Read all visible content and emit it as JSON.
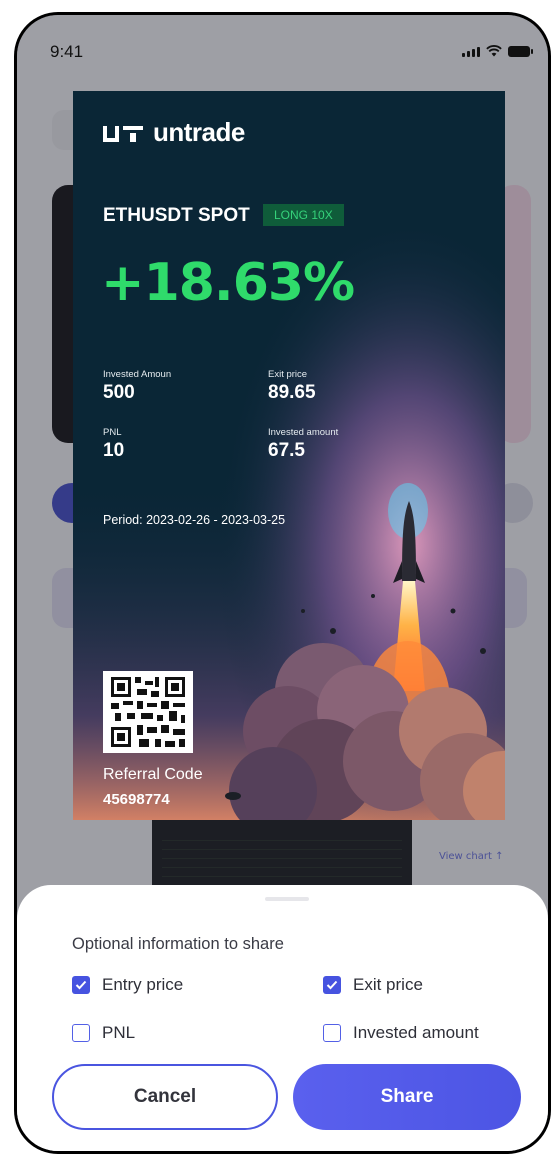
{
  "status_bar": {
    "time": "9:41"
  },
  "background": {
    "view_chart": "View chart ↑"
  },
  "share_card": {
    "brand": "untrade",
    "pair": "ETHUSDT SPOT",
    "position_badge": "LONG 10X",
    "pnl_percent": "+18.63%",
    "stats": [
      {
        "label": "Invested Amoun",
        "value": "500"
      },
      {
        "label": "Exit price",
        "value": "89.65"
      },
      {
        "label": "PNL",
        "value": "10"
      },
      {
        "label": "Invested amount",
        "value": "67.5"
      }
    ],
    "period": "Period: 2023-02-26  -  2023-03-25",
    "referral_label": "Referral Code",
    "referral_code": "45698774"
  },
  "sheet": {
    "title": "Optional information to share",
    "options": [
      {
        "label": "Entry price",
        "checked": true
      },
      {
        "label": "Exit price",
        "checked": true
      },
      {
        "label": "PNL",
        "checked": false
      },
      {
        "label": "Invested amount",
        "checked": false
      }
    ],
    "cancel_label": "Cancel",
    "share_label": "Share"
  },
  "colors": {
    "accent": "#4c55e4",
    "profit_green": "#2fdb6b",
    "card_bg": "#0a2636",
    "badge_bg": "#0f5c3a"
  }
}
